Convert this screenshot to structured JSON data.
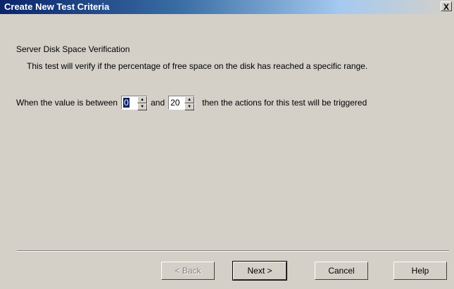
{
  "window": {
    "title": "Create New Test Criteria",
    "close_label": "X"
  },
  "content": {
    "heading": "Server Disk Space Verification",
    "description": "This test will verify if the percentage of free space on the disk has reached a specific range."
  },
  "criteria": {
    "prefix": "When the value is between",
    "min_value": "0",
    "conjunction": "and",
    "max_value": "20",
    "suffix": "then the actions for this test will be triggered"
  },
  "buttons": {
    "back": "< Back",
    "next": "Next >",
    "cancel": "Cancel",
    "help": "Help"
  }
}
